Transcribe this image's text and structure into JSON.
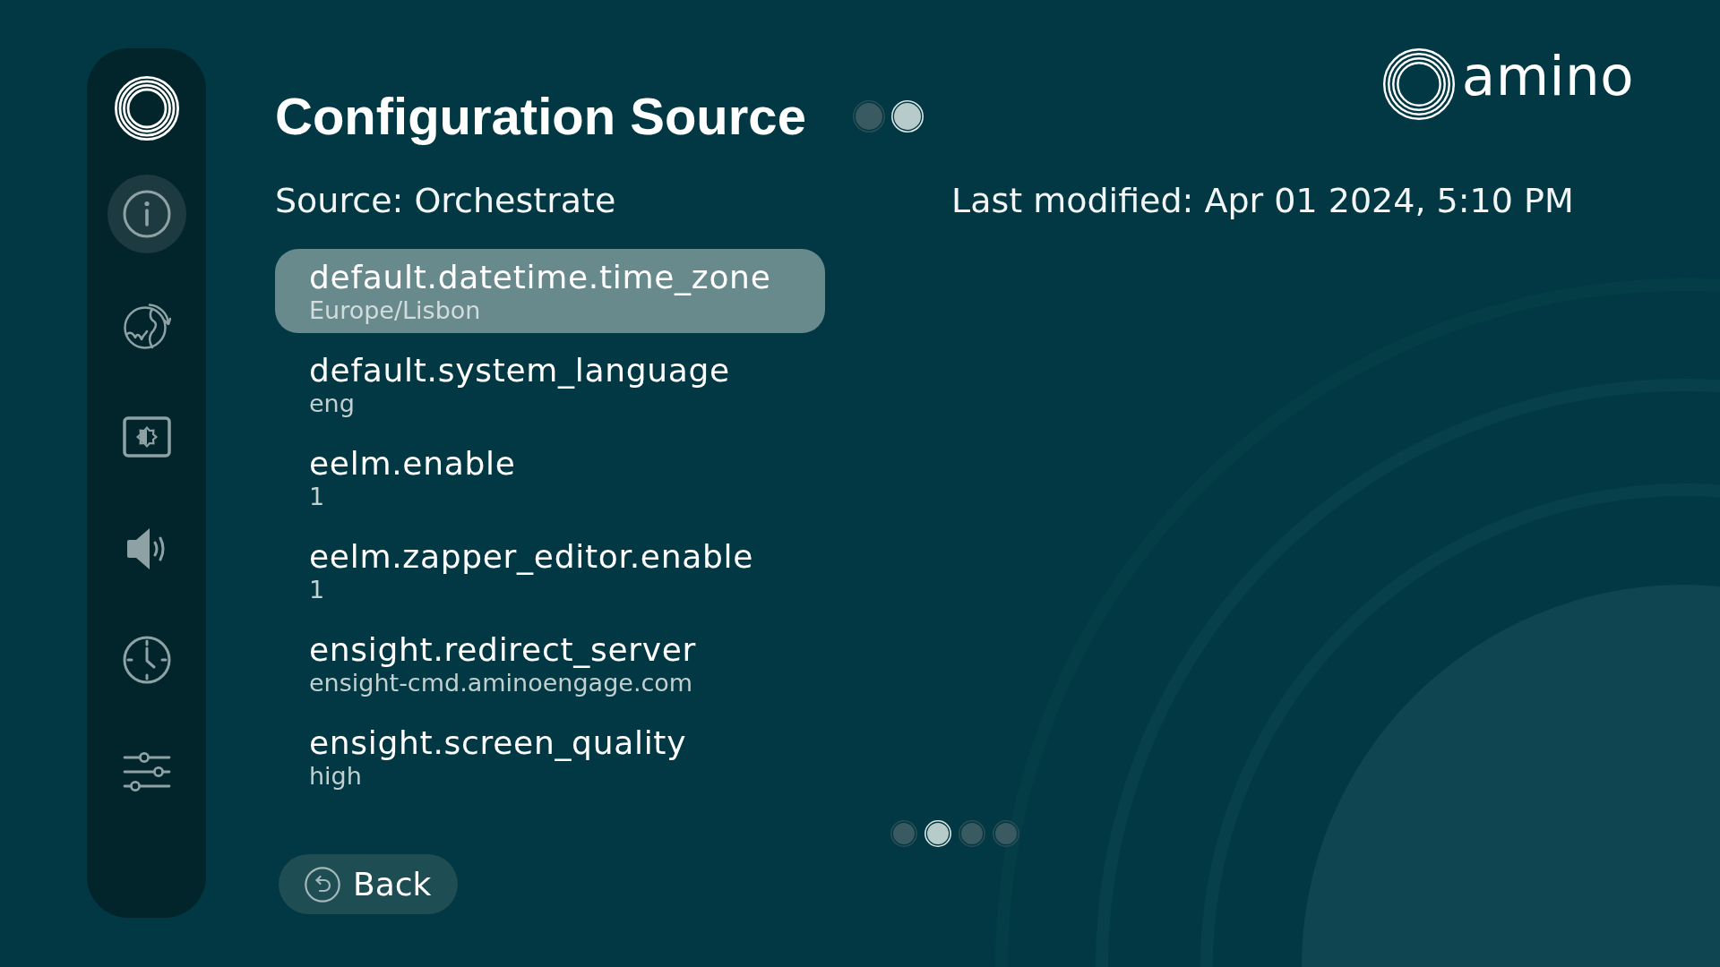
{
  "sidebar": {
    "items": [
      {
        "kind": "info",
        "selected": true
      },
      {
        "kind": "globe",
        "selected": false
      },
      {
        "kind": "display",
        "selected": false
      },
      {
        "kind": "sound",
        "selected": false
      },
      {
        "kind": "clock",
        "selected": false
      },
      {
        "kind": "sliders",
        "selected": false
      }
    ]
  },
  "header": {
    "title": "Configuration Source",
    "title_dots": [
      {
        "selected": false
      },
      {
        "selected": true
      }
    ]
  },
  "logo": {
    "text": "amino"
  },
  "source": "Source: Orchestrate",
  "last_modified": "Last modified: Apr 01 2024, 5:10 PM",
  "settings": [
    {
      "name": "default.datetime.time_zone",
      "value": "Europe/Lisbon",
      "selected": true
    },
    {
      "name": "default.system_language",
      "value": "eng",
      "selected": false
    },
    {
      "name": "eelm.enable",
      "value": "1",
      "selected": false
    },
    {
      "name": "eelm.zapper_editor.enable",
      "value": "1",
      "selected": false
    },
    {
      "name": "ensight.redirect_server",
      "value": "ensight-cmd.aminoengage.com",
      "selected": false
    },
    {
      "name": "ensight.screen_quality",
      "value": "high",
      "selected": false
    }
  ],
  "pagination": [
    {
      "selected": false
    },
    {
      "selected": true
    },
    {
      "selected": false
    },
    {
      "selected": false
    }
  ],
  "back_button": {
    "label": "Back"
  }
}
